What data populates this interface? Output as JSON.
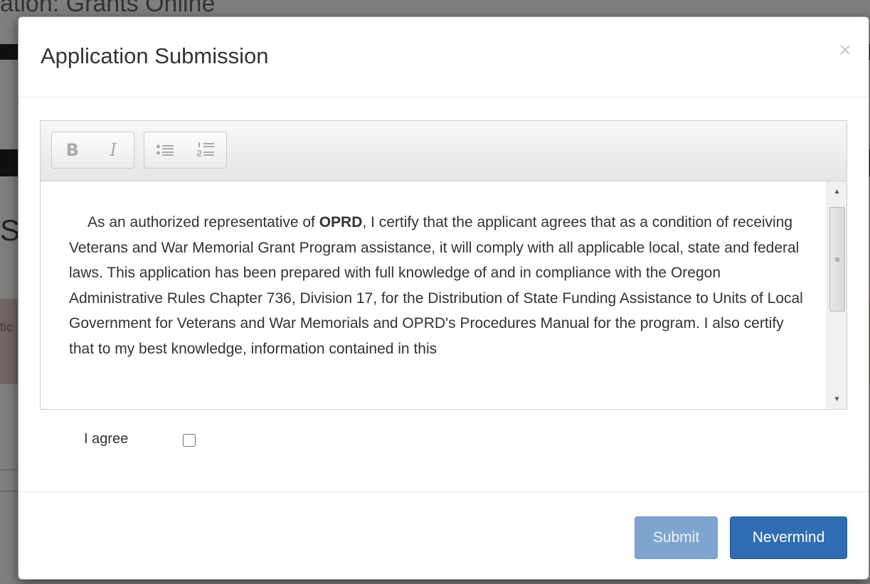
{
  "background": {
    "page_title": "ation: Grants Online",
    "heading_fragment": "S",
    "side_fragment": "tic"
  },
  "modal": {
    "title": "Application Submission",
    "close_label": "×",
    "toolbar": {
      "bold_label": "B",
      "italic_label": "I",
      "bullet_list_icon": "unordered-list-icon",
      "numbered_list_icon": "ordered-list-icon"
    },
    "content": {
      "text_before_org": "As an authorized representative of ",
      "organization": "OPRD",
      "text_after_org": ", I certify that the applicant agrees that as a condition of receiving Veterans and War Memorial Grant Program assistance, it will comply with all applicable local, state and federal laws. This application has been prepared with full knowledge of and in compliance with the Oregon Administrative Rules Chapter 736, Division 17, for the Distribution of State Funding Assistance to Units of Local Government for Veterans and War Memorials and OPRD's Procedures Manual for the program. I also certify that to my best knowledge, information contained in this"
    },
    "scrollbar": {
      "up_arrow": "▲",
      "down_arrow": "▼",
      "thumb_grip": "≡"
    },
    "agree": {
      "label": "I agree",
      "checked": false
    },
    "footer": {
      "submit_label": "Submit",
      "nevermind_label": "Nevermind"
    }
  },
  "colors": {
    "submit_bg": "#7fa5cf",
    "nevermind_bg": "#2f6cb0",
    "backdrop": "rgba(0,0,0,0.5)"
  }
}
